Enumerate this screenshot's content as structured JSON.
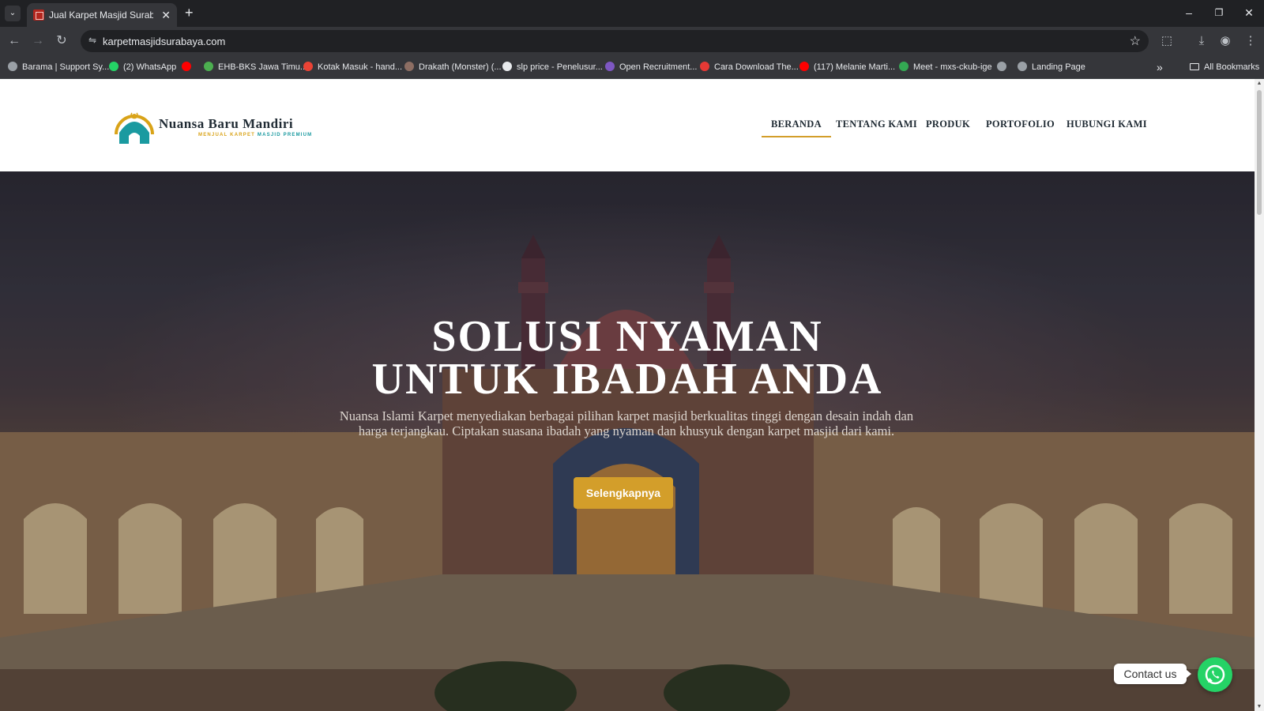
{
  "browser": {
    "tab": {
      "title": "Jual Karpet Masjid Surabaya - N",
      "close": "✕"
    },
    "new_tab": "+",
    "tab_list": "⌄",
    "window_controls": {
      "minimize": "–",
      "restore": "❐",
      "close": "✕"
    },
    "nav": {
      "back": "←",
      "forward": "→",
      "reload": "↻"
    },
    "site_info": "⇋",
    "url": "karpetmasjidsurabaya.com",
    "star": "☆",
    "toolbar_icons": {
      "extensions": "⬚",
      "download": "⤓",
      "profile": "◉",
      "menu": "⋮"
    },
    "bookmarks": [
      {
        "label": "Barama | Support Sy...",
        "icon_color": "#9aa0a6"
      },
      {
        "label": "(2) WhatsApp",
        "icon_color": "#25d366"
      },
      {
        "label": "",
        "icon_color": "#ff0000"
      },
      {
        "label": "EHB-BKS Jawa Timu...",
        "icon_color": "#4caf50"
      },
      {
        "label": "Kotak Masuk - hand...",
        "icon_color": "#ea4335"
      },
      {
        "label": "Drakath (Monster) (...",
        "icon_color": "#8d6e63"
      },
      {
        "label": "slp price - Penelusur...",
        "icon_color": "#e8eaed"
      },
      {
        "label": "Open Recruitment...",
        "icon_color": "#7e57c2"
      },
      {
        "label": "Cara Download The...",
        "icon_color": "#e53935"
      },
      {
        "label": "(117) Melanie Marti...",
        "icon_color": "#ff0000"
      },
      {
        "label": "Meet - mxs-ckub-ige",
        "icon_color": "#34a853"
      },
      {
        "label": "",
        "icon_color": "#9aa0a6"
      },
      {
        "label": "Landing Page",
        "icon_color": "#9aa0a6"
      }
    ],
    "bookmarks_overflow": "»",
    "all_bookmarks": "All Bookmarks"
  },
  "site": {
    "logo": {
      "name": "Nuansa Baru Mandiri",
      "tagline_1": "MENJUAL KARPET",
      "tagline_2": "MASJID PREMIUM"
    },
    "nav": [
      {
        "label": "BERANDA",
        "active": true
      },
      {
        "label": "TENTANG KAMI",
        "active": false
      },
      {
        "label": "PRODUK",
        "active": false
      },
      {
        "label": "PORTOFOLIO",
        "active": false
      },
      {
        "label": "HUBUNGI KAMI",
        "active": false
      }
    ],
    "hero": {
      "title_line_1": "SOLUSI NYAMAN",
      "title_line_2": "UNTUK IBADAH ANDA",
      "description": "Nuansa Islami Karpet menyediakan berbagai pilihan karpet masjid berkualitas tinggi dengan desain indah dan harga terjangkau. Ciptakan suasana ibadah yang nyaman dan khusyuk dengan karpet masjid dari kami.",
      "cta": "Selengkapnya"
    },
    "contact": {
      "label": "Contact us"
    }
  },
  "colors": {
    "accent": "#d39e2a",
    "whatsapp": "#25d366",
    "logo_teal": "#1a9aa0",
    "logo_gold": "#d9a318"
  }
}
